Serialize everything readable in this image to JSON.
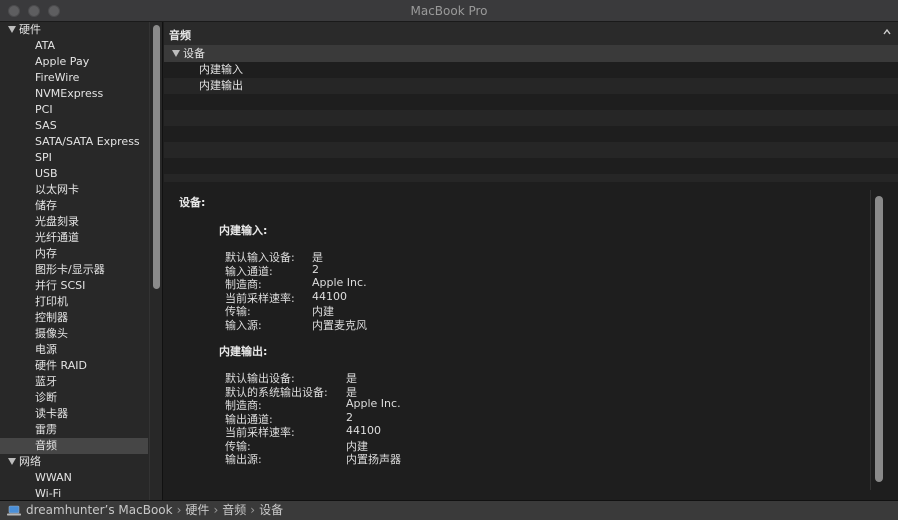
{
  "window": {
    "title": "MacBook Pro"
  },
  "sidebar": {
    "hardware": {
      "label": "硬件",
      "items": [
        "ATA",
        "Apple Pay",
        "FireWire",
        "NVMExpress",
        "PCI",
        "SAS",
        "SATA/SATA Express",
        "SPI",
        "USB",
        "以太网卡",
        "储存",
        "光盘刻录",
        "光纤通道",
        "内存",
        "图形卡/显示器",
        "并行 SCSI",
        "打印机",
        "控制器",
        "摄像头",
        "电源",
        "硬件 RAID",
        "蓝牙",
        "诊断",
        "读卡器",
        "雷雳",
        "音频"
      ]
    },
    "network": {
      "label": "网络",
      "items": [
        "WWAN",
        "Wi-Fi"
      ]
    },
    "selected": "音频"
  },
  "main": {
    "column_title": "音频",
    "tree": {
      "group_label": "设备",
      "items": [
        "内建输入",
        "内建输出"
      ]
    }
  },
  "detail": {
    "title": "设备:",
    "input": {
      "title": "内建输入:",
      "rows": [
        {
          "label": "默认输入设备:",
          "value": "是"
        },
        {
          "label": "输入通道:",
          "value": "2"
        },
        {
          "label": "制造商:",
          "value": "Apple Inc."
        },
        {
          "label": "当前采样速率:",
          "value": "44100"
        },
        {
          "label": "传输:",
          "value": "内建"
        },
        {
          "label": "输入源:",
          "value": "内置麦克风"
        }
      ]
    },
    "output": {
      "title": "内建输出:",
      "rows": [
        {
          "label": "默认输出设备:",
          "value": "是"
        },
        {
          "label": "默认的系统输出设备:",
          "value": "是"
        },
        {
          "label": "制造商:",
          "value": "Apple Inc."
        },
        {
          "label": "输出通道:",
          "value": "2"
        },
        {
          "label": "当前采样速率:",
          "value": "44100"
        },
        {
          "label": "传输:",
          "value": "内建"
        },
        {
          "label": "输出源:",
          "value": "内置扬声器"
        }
      ]
    }
  },
  "statusbar": {
    "breadcrumb": [
      "dreamhunter’s MacBook",
      "硬件",
      "音频",
      "设备"
    ],
    "separator": "›"
  },
  "colors": {
    "window_bg": "#1e1e1e",
    "sidebar_bg": "#282828",
    "selection_bg": "#464646",
    "text": "#dcdcdc"
  }
}
